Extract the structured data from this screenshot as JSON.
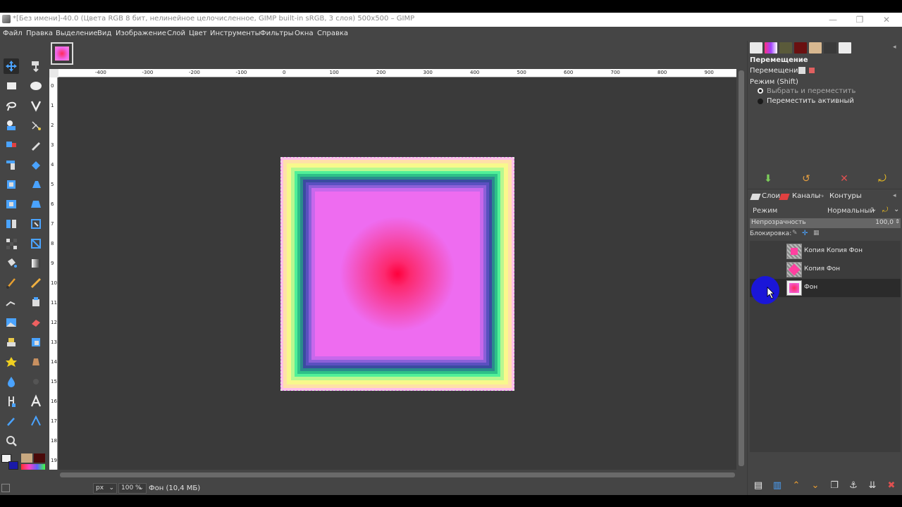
{
  "window": {
    "title": "*[Без имени]-40.0 (Цвета RGB 8 бит, нелинейное целочисленное, GIMP built-in sRGB, 3 слоя) 500x500 – GIMP",
    "controls": [
      "—",
      "❐",
      "✕"
    ]
  },
  "menu": [
    "Файл",
    "Правка",
    "Выделение",
    "Вид",
    "Изображение",
    "Слой",
    "Цвет",
    "Инструменты",
    "Фильтры",
    "Окна",
    "Справка"
  ],
  "toolbox": {
    "tools": [
      "move-tool",
      "align-tool",
      "rect-select-tool",
      "ellipse-select-tool",
      "free-select-tool",
      "fuzzy-select-tool",
      "foreground-select-tool",
      "scissors-tool",
      "crop-tool",
      "paths-tool",
      "unified-transform-tool",
      "warp-tool",
      "rotate-tool",
      "handle-transform-tool",
      "scale-tool",
      "perspective-tool",
      "flip-tool",
      "cage-tool",
      "shear-tool",
      "3d-transform-tool",
      "bucket-fill-tool",
      "gradient-tool",
      "paintbrush-tool",
      "pencil-tool",
      "ink-tool",
      "airbrush-tool",
      "mypaint-brush-tool",
      "eraser-tool",
      "clone-tool",
      "heal-tool",
      "perspective-clone-tool",
      "smudge-tool",
      "blur-tool",
      "dodge-tool",
      "text-tool",
      "color-picker-tool",
      "measure-tool",
      "zoom-tool"
    ],
    "fg_color": "#f2f2f2",
    "bg_color": "#1a1aa8"
  },
  "rulers": {
    "h_labels": [
      "-400",
      "-300",
      "-200",
      "-100",
      "0",
      "100",
      "200",
      "300",
      "400",
      "500",
      "600",
      "700",
      "800",
      "900"
    ],
    "v_labels": [
      "0",
      "1",
      "2",
      "3",
      "4",
      "5",
      "6",
      "7",
      "8",
      "9",
      "10",
      "11",
      "12",
      "13",
      "14",
      "15",
      "16",
      "17",
      "18",
      "19"
    ]
  },
  "statusbar": {
    "unit": "px",
    "zoom": "100 %",
    "info": "Фон (10,4 МБ)"
  },
  "tool_options": {
    "title": "Перемещение",
    "move_label": "Перемещение:",
    "mode_label": "Режим (Shift)",
    "options": [
      "Выбрать и переместить",
      "Переместить активный"
    ]
  },
  "layers_panel": {
    "tabs": [
      "Слои",
      "Каналы",
      "Контуры"
    ],
    "mode_label": "Режим",
    "mode_value": "Нормальный",
    "opacity_label": "Непрозрачность",
    "opacity_value": "100,0",
    "lock_label": "Блокировка:",
    "layers": [
      {
        "name": "Копия Копия Фон",
        "visible": false,
        "selected": false
      },
      {
        "name": "Копия Фон",
        "visible": false,
        "selected": false
      },
      {
        "name": "Фон",
        "visible": true,
        "selected": true
      }
    ]
  },
  "colors": {
    "panel_bg": "#454545",
    "viewport_bg": "#3a3a3a",
    "accent_blue": "#1a16d8"
  }
}
